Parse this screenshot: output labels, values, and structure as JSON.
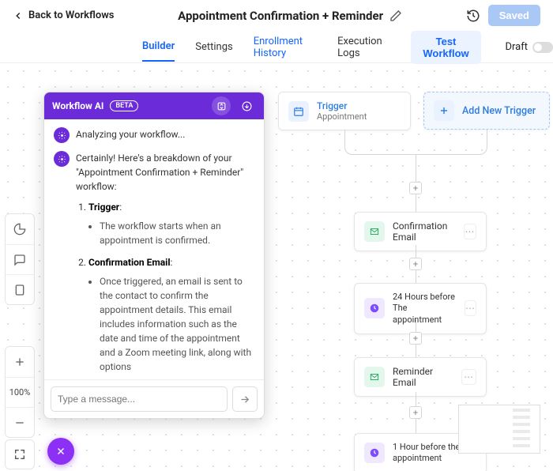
{
  "header": {
    "back": "Back to Workflows",
    "title": "Appointment Confirmation + Reminder",
    "saved": "Saved"
  },
  "tabs": {
    "builder": "Builder",
    "settings": "Settings",
    "enrollment": "Enrollment History",
    "execution": "Execution Logs",
    "test": "Test Workflow",
    "draft": "Draft"
  },
  "zoom": "100%",
  "ai": {
    "title": "Workflow AI",
    "beta": "BETA",
    "placeholder": "Type a message...",
    "m1": "Analyzing your workflow...",
    "m2_intro": "Certainly! Here's a breakdown of your \"Appointment Confirmation + Reminder\" workflow:",
    "s1_title": "Trigger",
    "s1_body": "The workflow starts when an appointment is confirmed.",
    "s2_title": "Confirmation Email",
    "s2_body": "Once triggered, an email is sent to the contact to confirm the appointment details. This email includes information such as the date and time of the appointment and a Zoom meeting link, along with options"
  },
  "nodes": {
    "trigger_t": "Trigger",
    "trigger_s": "Appointment",
    "add_trigger": "Add New Trigger",
    "conf_email": "Confirmation Email",
    "wait24": "24 Hours before The appointment",
    "reminder": "Reminder Email",
    "wait1": "1 Hour before the appointment"
  }
}
